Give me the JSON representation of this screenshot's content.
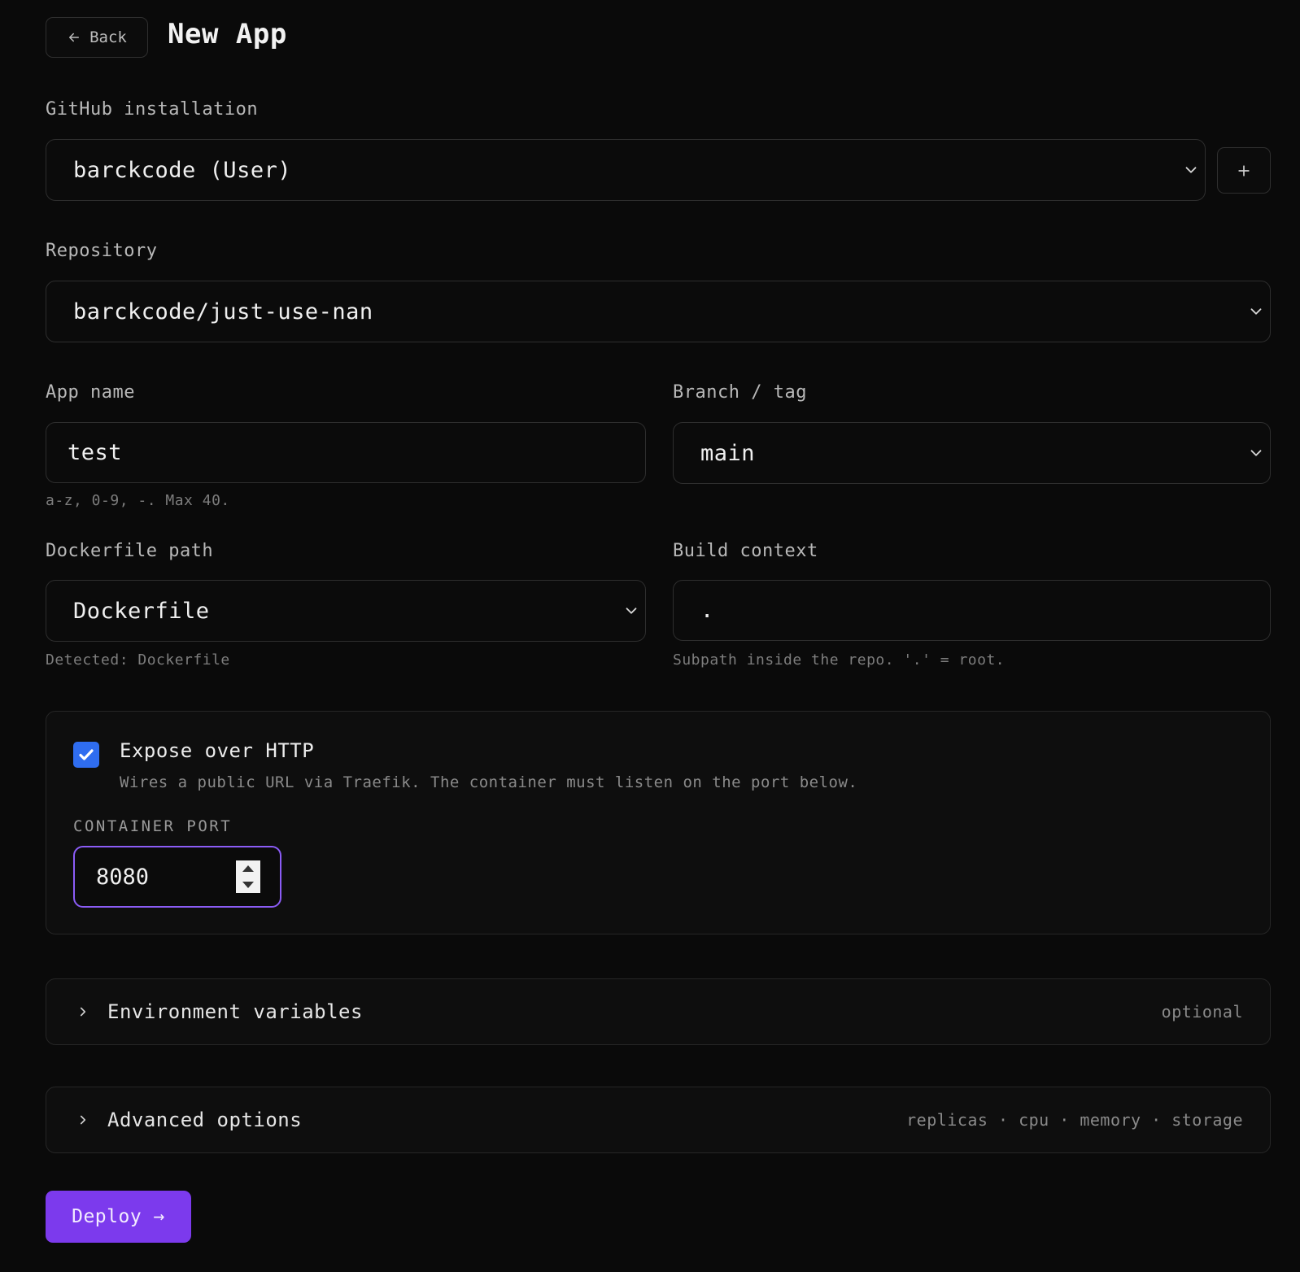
{
  "header": {
    "back_label": "Back",
    "title": "New App"
  },
  "github_installation": {
    "label": "GitHub installation",
    "value": "barckcode (User)"
  },
  "repository": {
    "label": "Repository",
    "value": "barckcode/just-use-nan"
  },
  "app_name": {
    "label": "App name",
    "value": "test",
    "hint": "a-z, 0-9, -. Max 40."
  },
  "branch": {
    "label": "Branch / tag",
    "value": "main"
  },
  "dockerfile": {
    "label": "Dockerfile path",
    "value": "Dockerfile",
    "hint": "Detected: Dockerfile"
  },
  "build_context": {
    "label": "Build context",
    "value": ".",
    "hint": "Subpath inside the repo. '.' = root."
  },
  "expose": {
    "checked": true,
    "title": "Expose over HTTP",
    "description": "Wires a public URL via Traefik. The container must listen on the port below.",
    "port_label": "CONTAINER PORT",
    "port_value": "8080"
  },
  "env_section": {
    "title": "Environment variables",
    "meta": "optional"
  },
  "advanced_section": {
    "title": "Advanced options",
    "meta": "replicas · cpu · memory · storage"
  },
  "deploy": {
    "label": "Deploy →"
  },
  "colors": {
    "background": "#0a0a0a",
    "accent": "#7c3aed",
    "focus_ring": "#8b5cf6",
    "checkbox": "#2f6df0"
  }
}
